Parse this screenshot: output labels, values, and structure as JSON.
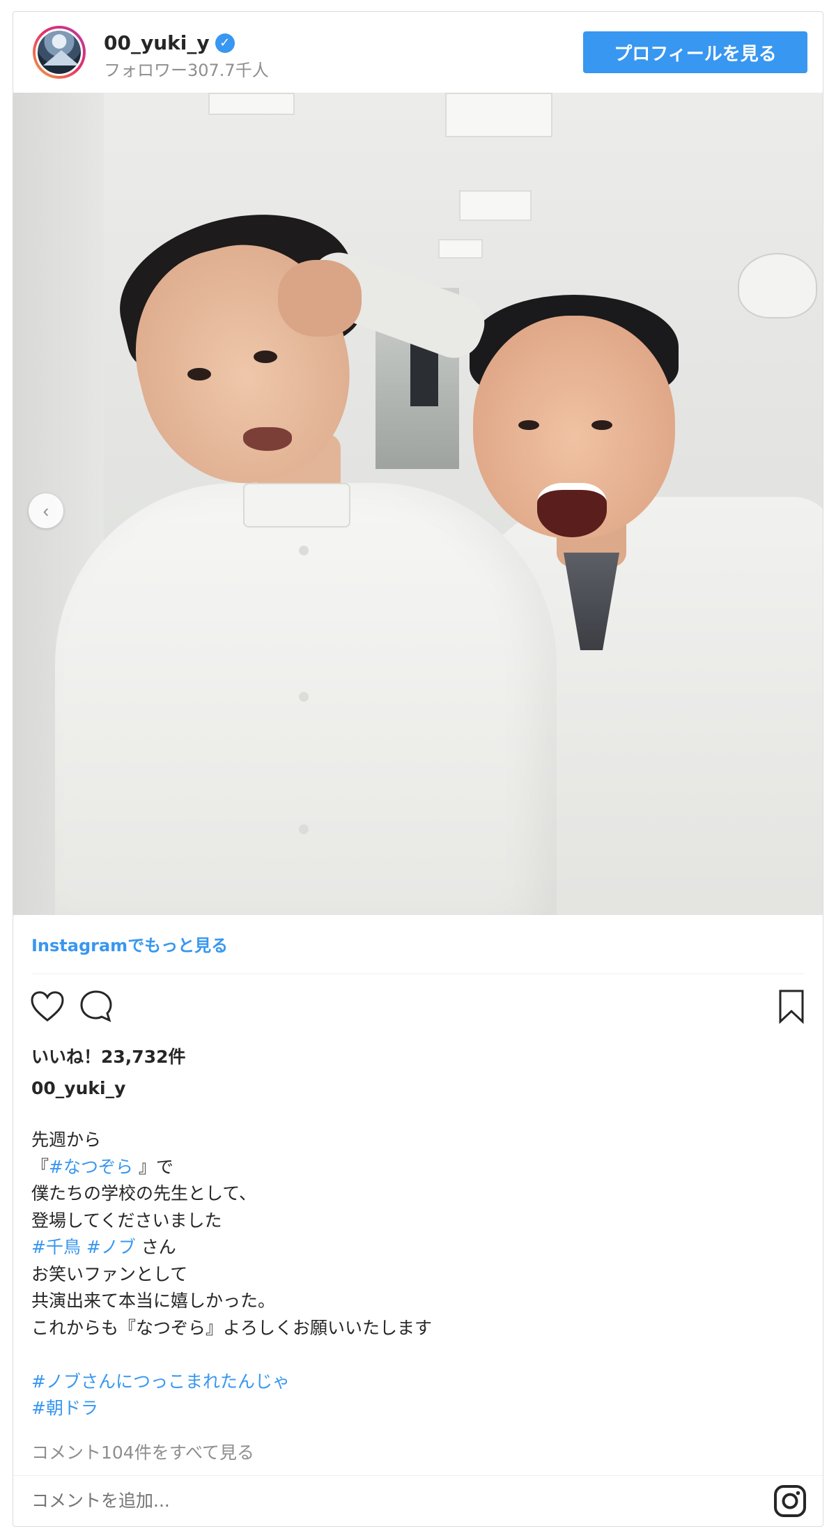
{
  "header": {
    "username": "00_yuki_y",
    "verified_mark": "✓",
    "followers": "フォロワー307.7千人",
    "profile_button": "プロフィールを見る"
  },
  "post": {
    "carousel_prev": "‹",
    "more_link": "Instagramでもっと見る",
    "likes_label": "いいね！",
    "likes_count": "23,732件",
    "caption_user": "00_yuki_y",
    "caption_lines": [
      {
        "parts": [
          {
            "text": "先週から",
            "tag": false
          }
        ]
      },
      {
        "parts": [
          {
            "text": "『",
            "tag": false
          },
          {
            "text": "#なつぞら",
            "tag": true
          },
          {
            "text": " 』で",
            "tag": false
          }
        ]
      },
      {
        "parts": [
          {
            "text": "僕たちの学校の先生として、",
            "tag": false
          }
        ]
      },
      {
        "parts": [
          {
            "text": "登場してくださいました",
            "tag": false
          }
        ]
      },
      {
        "parts": [
          {
            "text": "#千鳥",
            "tag": true
          },
          {
            "text": " ",
            "tag": false
          },
          {
            "text": "#ノブ",
            "tag": true
          },
          {
            "text": " さん",
            "tag": false
          }
        ]
      },
      {
        "parts": [
          {
            "text": "お笑いファンとして",
            "tag": false
          }
        ]
      },
      {
        "parts": [
          {
            "text": "共演出来て本当に嬉しかった。",
            "tag": false
          }
        ]
      },
      {
        "parts": [
          {
            "text": "これからも『なつぞら』よろしくお願いいたします",
            "tag": false
          }
        ]
      },
      {
        "parts": [
          {
            "text": "",
            "tag": false
          }
        ]
      },
      {
        "parts": [
          {
            "text": "#ノブさんにつっこまれたんじゃ",
            "tag": true
          }
        ]
      },
      {
        "parts": [
          {
            "text": "#朝ドラ",
            "tag": true
          }
        ]
      }
    ],
    "comments_link": "コメント104件をすべて見る",
    "add_comment_placeholder": "コメントを追加..."
  },
  "icons": [
    "heart-icon",
    "comment-icon",
    "bookmark-icon",
    "instagram-icon",
    "chevron-left-icon",
    "verified-icon"
  ],
  "colors": {
    "accent": "#3897f0",
    "text": "#262626",
    "muted": "#8e8e8e",
    "border": "#dbdbdb"
  }
}
